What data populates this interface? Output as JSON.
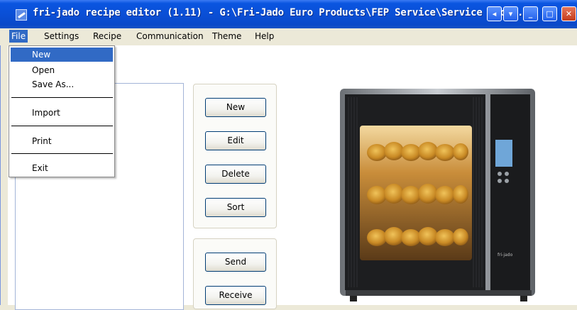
{
  "window": {
    "title": "fri-jado recipe editor (1.11)   - G:\\Fri-Jado Euro Products\\FEP Service\\Service Docu...",
    "controls": {
      "extra": "◂",
      "dropdown": "▾",
      "minimize": "_",
      "maximize": "□",
      "close": "✕"
    }
  },
  "menubar": {
    "file": "File",
    "settings": "Settings",
    "recipe": "Recipe",
    "communication": "Communication",
    "theme": "Theme",
    "help": "Help"
  },
  "file_menu": {
    "new": "New",
    "open": "Open",
    "save_as": "Save As...",
    "import": "Import",
    "print": "Print",
    "exit": "Exit"
  },
  "recipe_buttons": {
    "new": "New",
    "edit": "Edit",
    "delete": "Delete",
    "sort": "Sort"
  },
  "comm_buttons": {
    "send": "Send",
    "receive": "Receive"
  },
  "oven_brand": "fri-jado",
  "colors": {
    "titlebar": "#0a4fd6",
    "menu_highlight": "#316ac5",
    "button_border": "#003c74"
  }
}
